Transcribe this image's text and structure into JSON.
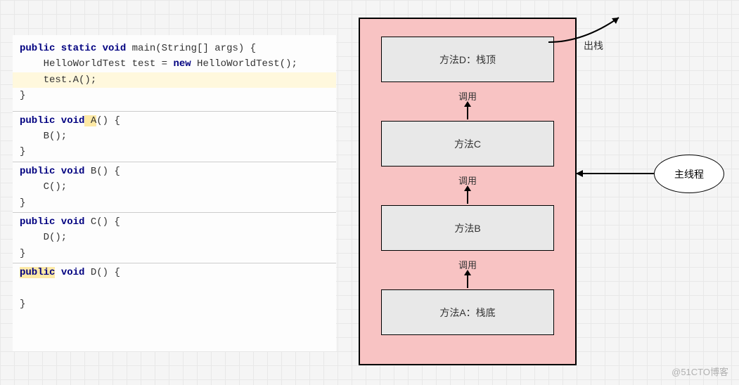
{
  "code": {
    "main_sig_pre": "public static void",
    "main_sig_mid": " main",
    "main_sig_post": "(String[] args) {",
    "main_l1_a": "    HelloWorldTest test = ",
    "main_l1_b": "new",
    "main_l1_c": " HelloWorldTest();",
    "main_l2": "    test.A();",
    "main_close": "}",
    "A_sig_pre": "public void",
    "A_name": " A",
    "A_sig_post": "() {",
    "A_body": "    B();",
    "A_close": "}",
    "B_sig_pre": "public void",
    "B_sig_post": " B() {",
    "B_body": "    C();",
    "B_close": "}",
    "C_sig_pre": "public void",
    "C_sig_post": " C() {",
    "C_body": "    D();",
    "C_close": "}",
    "D_sig_pre_hl": "public",
    "D_sig_pre2": " void",
    "D_sig_post": " D() {",
    "D_blank": " ",
    "D_close": "}"
  },
  "stack": {
    "frameD": "方法D：栈顶",
    "frameC": "方法C",
    "frameB": "方法B",
    "frameA": "方法A：栈底",
    "call": "调用"
  },
  "labels": {
    "pop": "出栈",
    "thread": "主线程",
    "watermark": "@51CTO博客"
  },
  "chart_data": {
    "type": "diagram",
    "description": "Java call stack of methods A→B→C→D within main thread",
    "stack_frames_top_to_bottom": [
      "方法D：栈顶",
      "方法C",
      "方法B",
      "方法A：栈底"
    ],
    "calls": [
      "A calls B",
      "B calls C",
      "C calls D"
    ],
    "pop_action_from": "方法D",
    "owner_thread": "主线程"
  }
}
